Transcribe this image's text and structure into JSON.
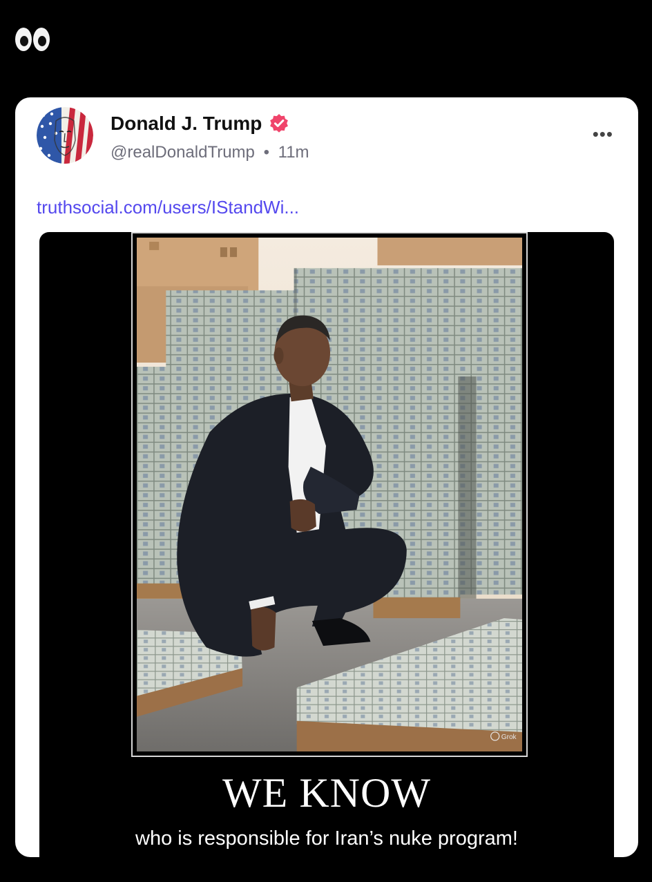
{
  "header": {
    "emoji": "👀"
  },
  "post": {
    "author_name": "Donald J. Trump",
    "handle": "@realDonaldTrump",
    "separator": "•",
    "time": "11m",
    "link_text": "truthsocial.com/users/IStandWi...",
    "more_label": "•••",
    "verified_color": "#f0446b",
    "link_color": "#5448ee"
  },
  "meme": {
    "headline": "WE KNOW",
    "subline": "who is responsible for Iran’s nuke program!",
    "watermark": "ⓘ Grok"
  }
}
